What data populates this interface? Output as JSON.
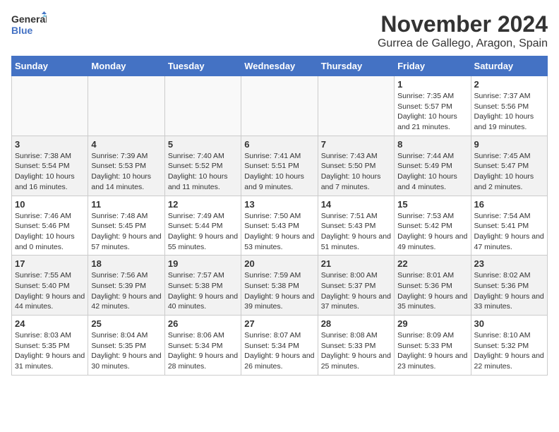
{
  "logo": {
    "line1": "General",
    "line2": "Blue"
  },
  "title": "November 2024",
  "location": "Gurrea de Gallego, Aragon, Spain",
  "days_header": [
    "Sunday",
    "Monday",
    "Tuesday",
    "Wednesday",
    "Thursday",
    "Friday",
    "Saturday"
  ],
  "weeks": [
    [
      {
        "day": "",
        "info": ""
      },
      {
        "day": "",
        "info": ""
      },
      {
        "day": "",
        "info": ""
      },
      {
        "day": "",
        "info": ""
      },
      {
        "day": "",
        "info": ""
      },
      {
        "day": "1",
        "info": "Sunrise: 7:35 AM\nSunset: 5:57 PM\nDaylight: 10 hours and 21 minutes."
      },
      {
        "day": "2",
        "info": "Sunrise: 7:37 AM\nSunset: 5:56 PM\nDaylight: 10 hours and 19 minutes."
      }
    ],
    [
      {
        "day": "3",
        "info": "Sunrise: 7:38 AM\nSunset: 5:54 PM\nDaylight: 10 hours and 16 minutes."
      },
      {
        "day": "4",
        "info": "Sunrise: 7:39 AM\nSunset: 5:53 PM\nDaylight: 10 hours and 14 minutes."
      },
      {
        "day": "5",
        "info": "Sunrise: 7:40 AM\nSunset: 5:52 PM\nDaylight: 10 hours and 11 minutes."
      },
      {
        "day": "6",
        "info": "Sunrise: 7:41 AM\nSunset: 5:51 PM\nDaylight: 10 hours and 9 minutes."
      },
      {
        "day": "7",
        "info": "Sunrise: 7:43 AM\nSunset: 5:50 PM\nDaylight: 10 hours and 7 minutes."
      },
      {
        "day": "8",
        "info": "Sunrise: 7:44 AM\nSunset: 5:49 PM\nDaylight: 10 hours and 4 minutes."
      },
      {
        "day": "9",
        "info": "Sunrise: 7:45 AM\nSunset: 5:47 PM\nDaylight: 10 hours and 2 minutes."
      }
    ],
    [
      {
        "day": "10",
        "info": "Sunrise: 7:46 AM\nSunset: 5:46 PM\nDaylight: 10 hours and 0 minutes."
      },
      {
        "day": "11",
        "info": "Sunrise: 7:48 AM\nSunset: 5:45 PM\nDaylight: 9 hours and 57 minutes."
      },
      {
        "day": "12",
        "info": "Sunrise: 7:49 AM\nSunset: 5:44 PM\nDaylight: 9 hours and 55 minutes."
      },
      {
        "day": "13",
        "info": "Sunrise: 7:50 AM\nSunset: 5:43 PM\nDaylight: 9 hours and 53 minutes."
      },
      {
        "day": "14",
        "info": "Sunrise: 7:51 AM\nSunset: 5:43 PM\nDaylight: 9 hours and 51 minutes."
      },
      {
        "day": "15",
        "info": "Sunrise: 7:53 AM\nSunset: 5:42 PM\nDaylight: 9 hours and 49 minutes."
      },
      {
        "day": "16",
        "info": "Sunrise: 7:54 AM\nSunset: 5:41 PM\nDaylight: 9 hours and 47 minutes."
      }
    ],
    [
      {
        "day": "17",
        "info": "Sunrise: 7:55 AM\nSunset: 5:40 PM\nDaylight: 9 hours and 44 minutes."
      },
      {
        "day": "18",
        "info": "Sunrise: 7:56 AM\nSunset: 5:39 PM\nDaylight: 9 hours and 42 minutes."
      },
      {
        "day": "19",
        "info": "Sunrise: 7:57 AM\nSunset: 5:38 PM\nDaylight: 9 hours and 40 minutes."
      },
      {
        "day": "20",
        "info": "Sunrise: 7:59 AM\nSunset: 5:38 PM\nDaylight: 9 hours and 39 minutes."
      },
      {
        "day": "21",
        "info": "Sunrise: 8:00 AM\nSunset: 5:37 PM\nDaylight: 9 hours and 37 minutes."
      },
      {
        "day": "22",
        "info": "Sunrise: 8:01 AM\nSunset: 5:36 PM\nDaylight: 9 hours and 35 minutes."
      },
      {
        "day": "23",
        "info": "Sunrise: 8:02 AM\nSunset: 5:36 PM\nDaylight: 9 hours and 33 minutes."
      }
    ],
    [
      {
        "day": "24",
        "info": "Sunrise: 8:03 AM\nSunset: 5:35 PM\nDaylight: 9 hours and 31 minutes."
      },
      {
        "day": "25",
        "info": "Sunrise: 8:04 AM\nSunset: 5:35 PM\nDaylight: 9 hours and 30 minutes."
      },
      {
        "day": "26",
        "info": "Sunrise: 8:06 AM\nSunset: 5:34 PM\nDaylight: 9 hours and 28 minutes."
      },
      {
        "day": "27",
        "info": "Sunrise: 8:07 AM\nSunset: 5:34 PM\nDaylight: 9 hours and 26 minutes."
      },
      {
        "day": "28",
        "info": "Sunrise: 8:08 AM\nSunset: 5:33 PM\nDaylight: 9 hours and 25 minutes."
      },
      {
        "day": "29",
        "info": "Sunrise: 8:09 AM\nSunset: 5:33 PM\nDaylight: 9 hours and 23 minutes."
      },
      {
        "day": "30",
        "info": "Sunrise: 8:10 AM\nSunset: 5:32 PM\nDaylight: 9 hours and 22 minutes."
      }
    ]
  ]
}
